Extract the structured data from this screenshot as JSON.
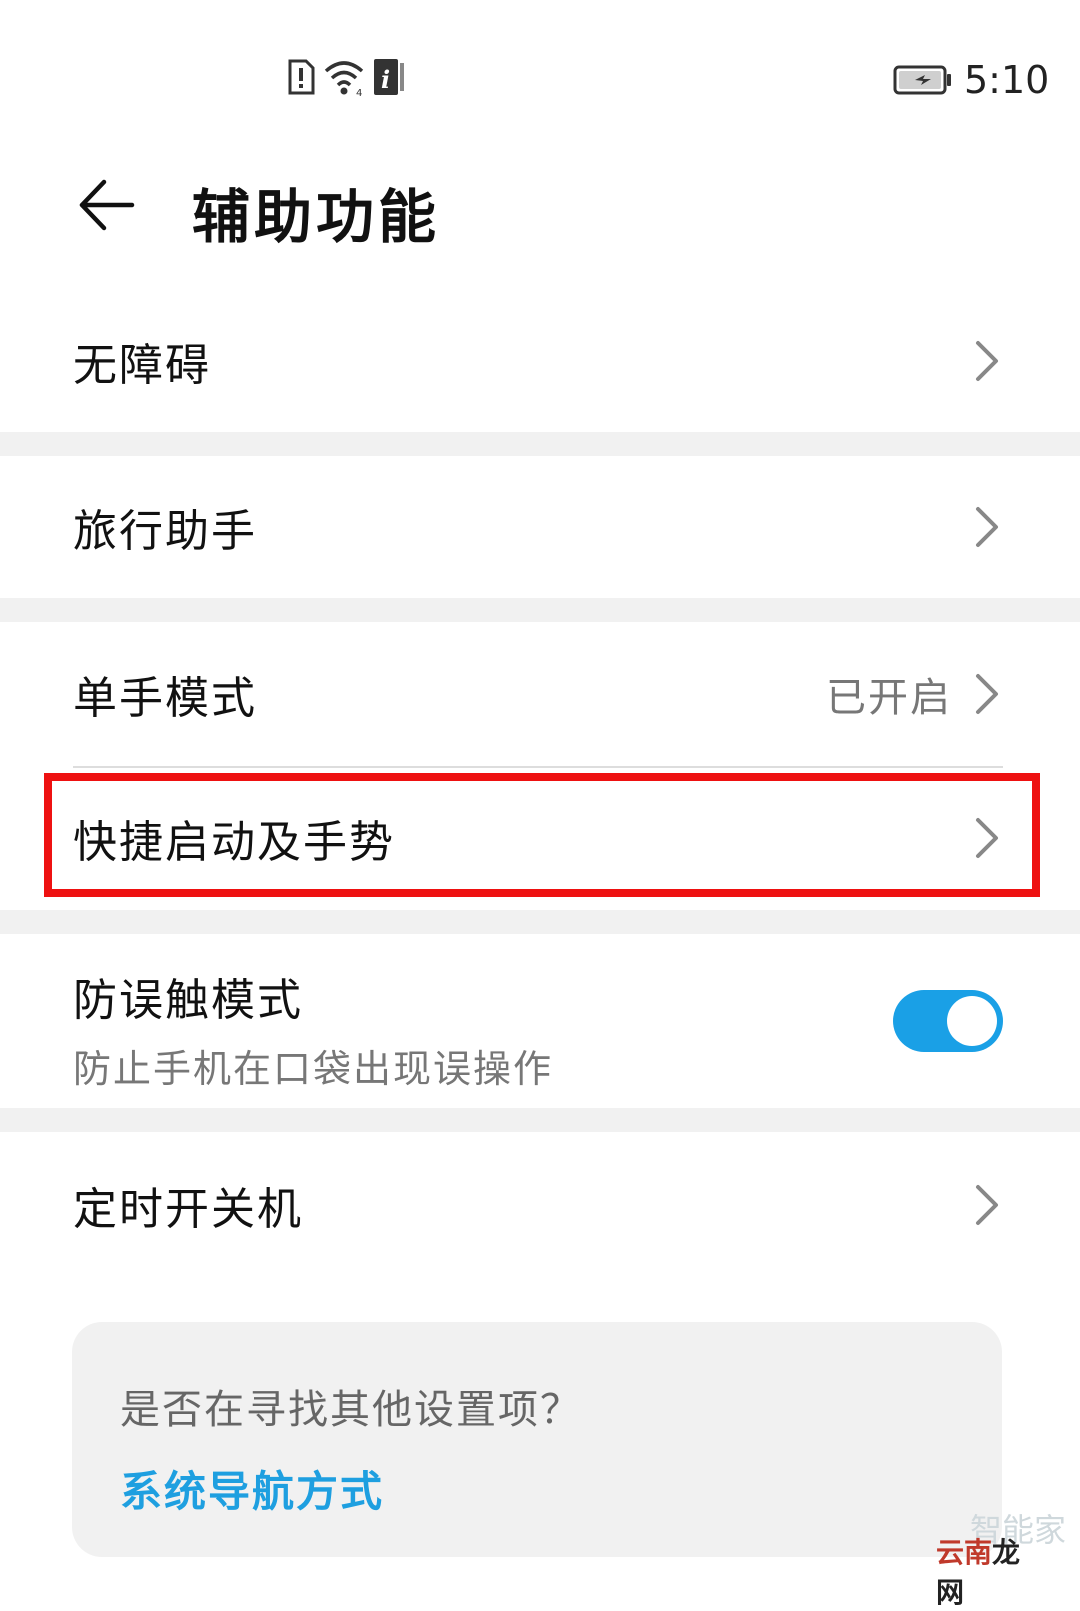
{
  "status_bar": {
    "time": "5:10",
    "icons": [
      "sim-alert-icon",
      "wifi-icon",
      "info-icon"
    ],
    "battery": "battery-charging-icon"
  },
  "header": {
    "title": "辅助功能",
    "back_icon": "back-arrow-icon"
  },
  "menu": {
    "accessibility": {
      "label": "无障碍"
    },
    "travel_assistant": {
      "label": "旅行助手"
    },
    "one_hand_mode": {
      "label": "单手模式",
      "value": "已开启"
    },
    "shortcuts_gestures": {
      "label": "快捷启动及手势",
      "highlighted": true,
      "highlight_color": "#ee1111"
    },
    "accidental_touch": {
      "label": "防误触模式",
      "description": "防止手机在口袋出现误操作",
      "enabled": true,
      "toggle_color": "#1aa0e6"
    },
    "scheduled_power": {
      "label": "定时开关机"
    }
  },
  "suggestion": {
    "question": "是否在寻找其他设置项？",
    "link": "系统导航方式",
    "link_color": "#1e9fe0"
  },
  "watermark": {
    "top": "智能家",
    "bottom_red": "云南",
    "bottom_black": "龙网"
  }
}
